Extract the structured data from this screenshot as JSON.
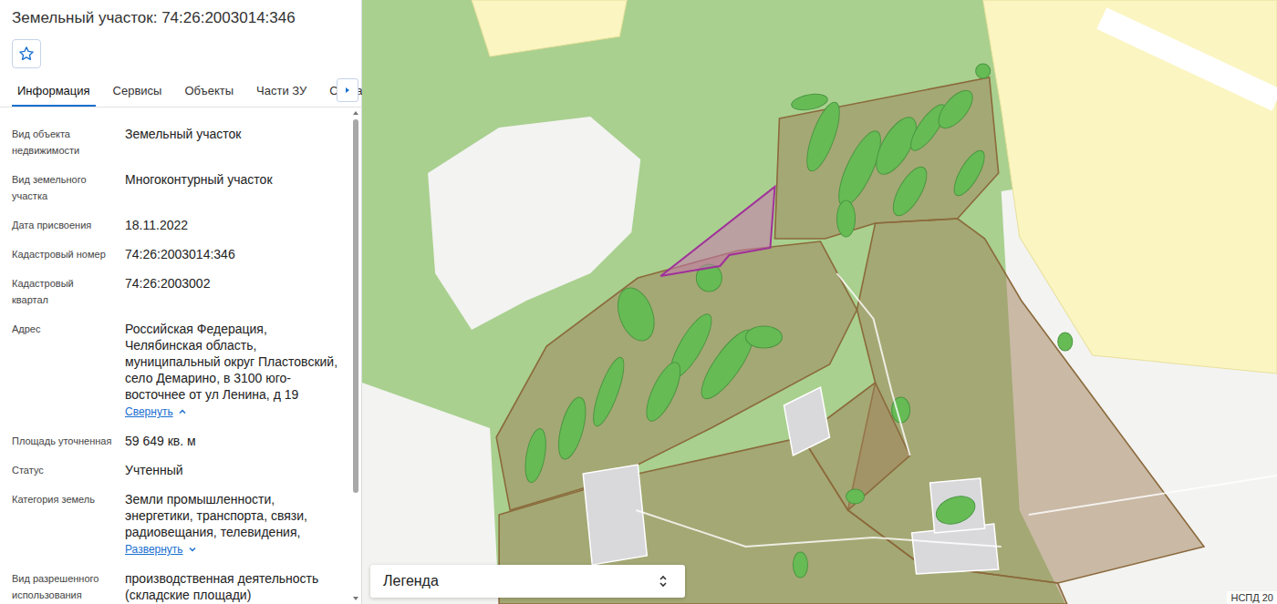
{
  "header": {
    "title": "Земельный участок: 74:26:2003014:346"
  },
  "favorite": {
    "active": false
  },
  "tabs": [
    {
      "label": "Информация",
      "selected": true
    },
    {
      "label": "Сервисы",
      "selected": false
    },
    {
      "label": "Объекты",
      "selected": false
    },
    {
      "label": "Части ЗУ",
      "selected": false
    },
    {
      "label": "Состав",
      "selected": false
    }
  ],
  "fields": [
    {
      "label": "Вид объекта недвижимости",
      "value": "Земельный участок"
    },
    {
      "label": "Вид земельного участка",
      "value": "Многоконтурный участок"
    },
    {
      "label": "Дата присвоения",
      "value": "18.11.2022"
    },
    {
      "label": "Кадастровый номер",
      "value": "74:26:2003014:346"
    },
    {
      "label": "Кадастровый квартал",
      "value": "74:26:2003002"
    },
    {
      "label": "Адрес",
      "value": "Российская Федерация, Челябинская область, муниципальный округ Пластовский, село Демарино, в 3100 юго-восточнее от ул Ленина, д 19",
      "toggle": {
        "text": "Свернуть",
        "expanded": true
      }
    },
    {
      "label": "Площадь уточненная",
      "value": "59 649 кв. м"
    },
    {
      "label": "Статус",
      "value": "Учтенный"
    },
    {
      "label": "Категория земель",
      "value": "Земли промышленности, энергетики, транспорта, связи, радиовещания, телевидения,",
      "toggle": {
        "text": "Развернуть",
        "expanded": false
      }
    },
    {
      "label": "Вид разрешенного использования",
      "value": "производственная деятельность (складские площади)"
    }
  ],
  "scrollbar": {
    "level": 0.79
  },
  "map": {
    "legend": {
      "label": "Легенда"
    },
    "attribution": "НСПД 20"
  }
}
